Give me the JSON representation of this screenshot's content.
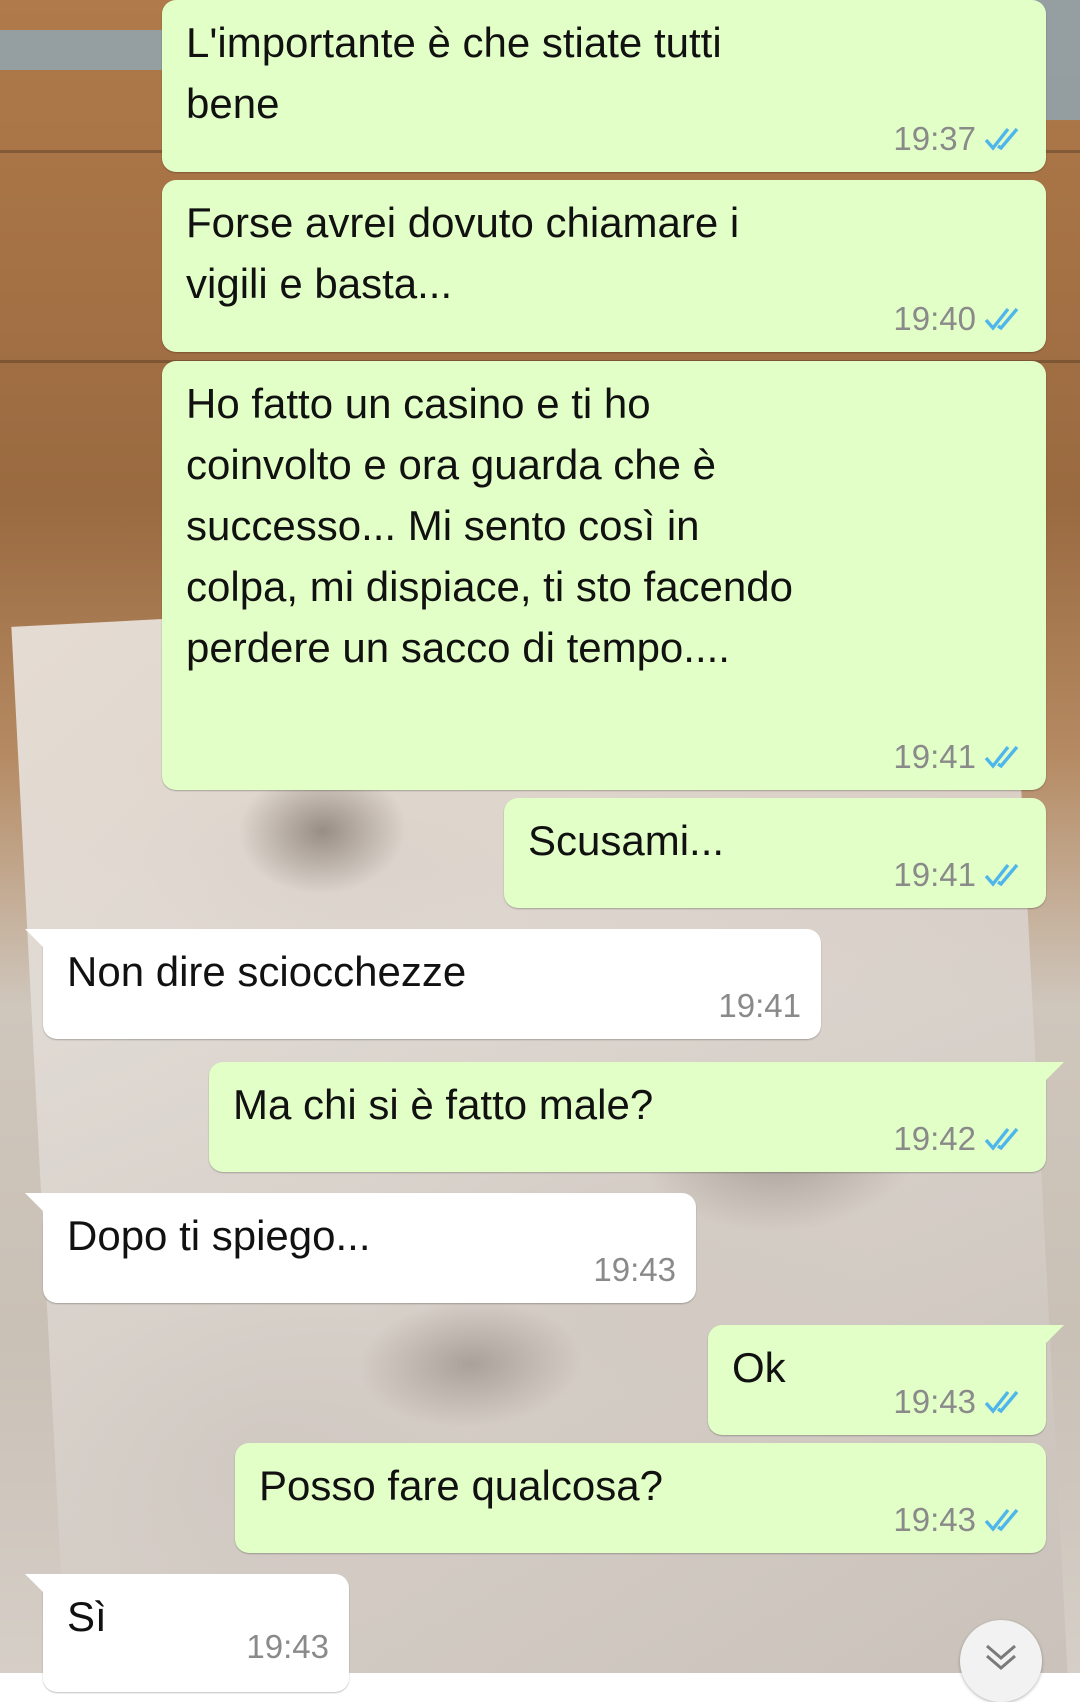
{
  "chat": {
    "messages": [
      {
        "direction": "out",
        "text": "L'importante è che stiate tutti\nbene",
        "time": "19:37",
        "status": "read"
      },
      {
        "direction": "out",
        "text": "Forse avrei dovuto chiamare i\nvigili e basta...",
        "time": "19:40",
        "status": "read"
      },
      {
        "direction": "out",
        "text": "Ho fatto un casino e ti ho\ncoinvolto e ora guarda che è\nsuccesso... Mi sento così in\ncolpa, mi dispiace, ti sto facendo\nperdere un sacco di tempo....",
        "time": "19:41",
        "status": "read"
      },
      {
        "direction": "out",
        "text": "Scusami...",
        "time": "19:41",
        "status": "read"
      },
      {
        "direction": "in",
        "text": "Non dire sciocchezze",
        "time": "19:41"
      },
      {
        "direction": "out",
        "text": "Ma chi si è fatto male?",
        "time": "19:42",
        "status": "read"
      },
      {
        "direction": "in",
        "text": "Dopo ti spiego...",
        "time": "19:43"
      },
      {
        "direction": "out",
        "text": "Ok",
        "time": "19:43",
        "status": "read"
      },
      {
        "direction": "out",
        "text": "Posso fare qualcosa?",
        "time": "19:43",
        "status": "read"
      },
      {
        "direction": "in",
        "text": "Sì",
        "time": "19:43"
      }
    ],
    "scroll_down_icon": "double-chevron-down-icon"
  },
  "colors": {
    "outgoing_bubble": "#e2ffc7",
    "incoming_bubble": "#ffffff",
    "read_ticks": "#4fb6ec",
    "timestamp": "#8a8a8a"
  }
}
